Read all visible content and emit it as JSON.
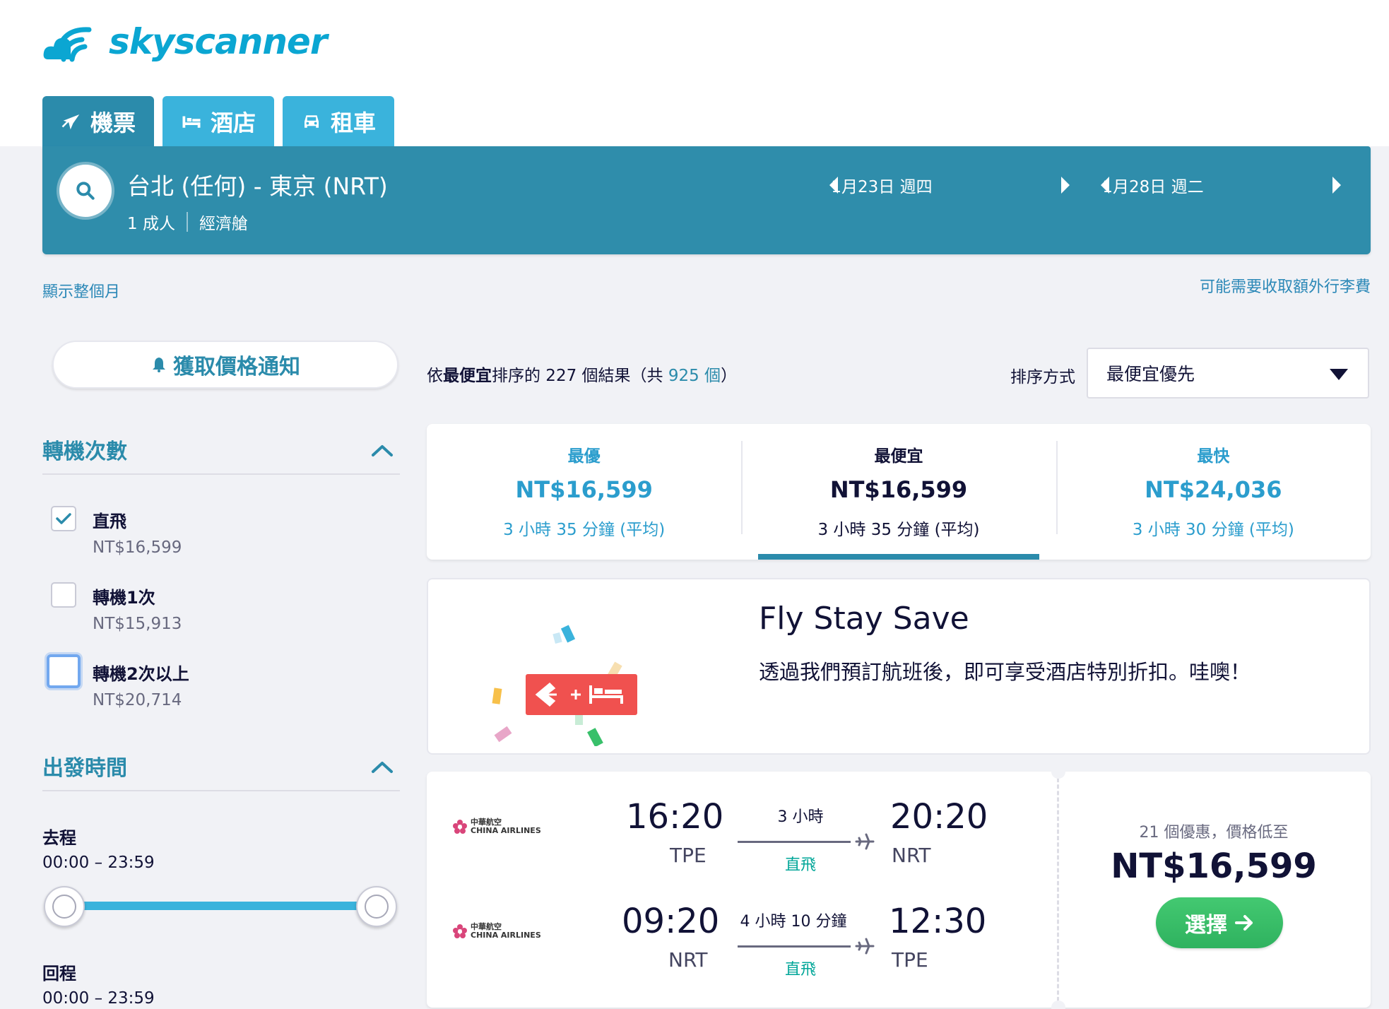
{
  "brand": {
    "name": "skyscanner"
  },
  "tabs": [
    {
      "label": "機票",
      "icon": "plane-icon",
      "active": true
    },
    {
      "label": "酒店",
      "icon": "bed-icon",
      "active": false
    },
    {
      "label": "租車",
      "icon": "car-icon",
      "active": false
    }
  ],
  "search": {
    "route": "台北 (任何) - 東京 (NRT)",
    "passengers": "1 成人",
    "cabin": "經濟艙",
    "depart_date": "1月23日 週四",
    "return_date": "1月28日 週二"
  },
  "links": {
    "show_month": "顯示整個月",
    "baggage_fee": "可能需要收取額外行李費"
  },
  "price_alert": {
    "label": "獲取價格通知"
  },
  "filters": {
    "stops": {
      "title": "轉機次數",
      "options": [
        {
          "label": "直飛",
          "price": "NT$16,599",
          "checked": true
        },
        {
          "label": "轉機1次",
          "price": "NT$15,913",
          "checked": false
        },
        {
          "label": "轉機2次以上",
          "price": "NT$20,714",
          "checked": false
        }
      ]
    },
    "departure_time": {
      "title": "出發時間",
      "outbound_label": "去程",
      "outbound_range": "00:00 – 23:59",
      "return_label": "回程",
      "return_range": "00:00 – 23:59"
    }
  },
  "results": {
    "prefix": "依",
    "sort_word": "最便宜",
    "mid": "排序的 227 個結果（共 ",
    "total": "925 個",
    "suffix": "）",
    "sort_label": "排序方式",
    "sort_value": "最便宜優先"
  },
  "sort_tabs": [
    {
      "label": "最優",
      "price": "NT$16,599",
      "duration": "3 小時 35 分鐘 (平均)"
    },
    {
      "label": "最便宜",
      "price": "NT$16,599",
      "duration": "3 小時 35 分鐘 (平均)"
    },
    {
      "label": "最快",
      "price": "NT$24,036",
      "duration": "3 小時 30 分鐘 (平均)"
    }
  ],
  "promo": {
    "title": "Fly Stay Save",
    "text": "透過我們預訂航班後，即可享受酒店特別折扣。哇噢！"
  },
  "flight": {
    "airline": "CHINA AIRLINES",
    "airline_native": "中華航空",
    "legs": [
      {
        "depart_time": "16:20",
        "depart_code": "TPE",
        "duration": "3 小時",
        "stops": "直飛",
        "arrive_time": "20:20",
        "arrive_code": "NRT"
      },
      {
        "depart_time": "09:20",
        "depart_code": "NRT",
        "duration": "4 小時 10 分鐘",
        "stops": "直飛",
        "arrive_time": "12:30",
        "arrive_code": "TPE"
      }
    ],
    "deals": "21 個優惠，價格低至",
    "price": "NT$16,599",
    "select_label": "選擇"
  },
  "colors": {
    "brand": "#0ba6d2",
    "header": "#2f8dab",
    "accent": "#2b8bab",
    "direct": "#00a698",
    "select": "#38c06a"
  }
}
